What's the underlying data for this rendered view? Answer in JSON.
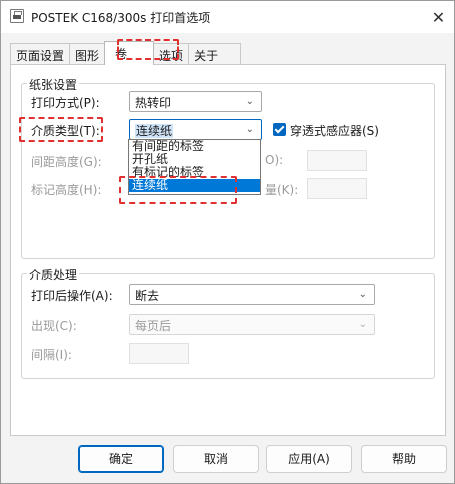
{
  "window": {
    "title": "POSTEK C168/300s 打印首选项",
    "close_glyph": "✕"
  },
  "tabs": [
    {
      "label": "页面设置"
    },
    {
      "label": "图形"
    },
    {
      "label": "卷"
    },
    {
      "label": "选项"
    },
    {
      "label": "关于"
    }
  ],
  "paper_settings": {
    "group_label": "纸张设置",
    "print_method_label": "打印方式(P):",
    "print_method_value": "热转印",
    "media_type_label": "介质类型(T):",
    "media_type_value": "连续纸",
    "transmissive_sensor_label": "穿透式感应器(S)",
    "transmissive_sensor_checked": true,
    "gap_height_label": "间距高度(G):",
    "gap_right_suffix": "O):",
    "mark_height_label": "标记高度(H):",
    "mark_right_suffix": "量(K):",
    "media_type_options": [
      "有间距的标签",
      "开孔纸",
      "有标记的标签",
      "连续纸"
    ],
    "media_type_selected_index": 3
  },
  "media_handling": {
    "group_label": "介质处理",
    "post_print_label": "打印后操作(A):",
    "post_print_value": "断去",
    "occurrence_label": "出现(C):",
    "occurrence_value": "每页后",
    "interval_label": "间隔(I):"
  },
  "buttons": {
    "ok": "确定",
    "cancel": "取消",
    "apply": "应用(A)",
    "help": "帮助"
  },
  "icons": {
    "dropdown": "chevron-down-icon",
    "app": "printer-icon"
  },
  "chevron_glyph": "⌄",
  "colors": {
    "accent": "#0067c0",
    "annotation": "#e03030",
    "selection": "#0078d7"
  }
}
